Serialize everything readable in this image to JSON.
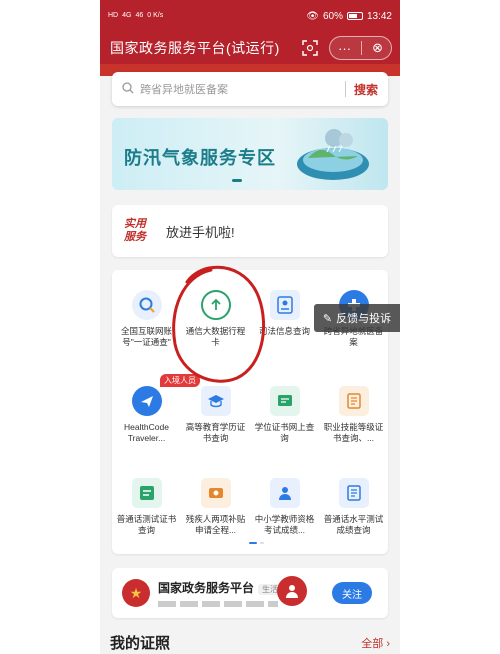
{
  "status_bar": {
    "left_icons": [
      "HD",
      "4G",
      "46",
      "0 K/s"
    ],
    "battery": "60%",
    "time": "13:42"
  },
  "title_bar": {
    "title": "国家政务服务平台(试运行)",
    "more": "···",
    "close": "⊗"
  },
  "search": {
    "placeholder": "跨省异地就医备案",
    "button": "搜索"
  },
  "flood_banner": {
    "title": "防汛气象服务专区"
  },
  "practical_service": {
    "tag_line1": "实用",
    "tag_line2": "服务",
    "notice": "放进手机啦!"
  },
  "grid": {
    "items": [
      {
        "label": "全国互联网账号\"一证通查\"",
        "icon": "search-icon",
        "color": "#2c7be5"
      },
      {
        "label": "通信大数据行程卡",
        "icon": "arrow-up-icon",
        "color": "#2aa36b"
      },
      {
        "label": "司法信息查询",
        "icon": "id-card-icon",
        "color": "#2c7be5"
      },
      {
        "label": "跨省异地就医备案",
        "icon": "medical-icon",
        "color": "#2c7be5"
      },
      {
        "label": "HealthCode Traveler...",
        "icon": "plane-icon",
        "color": "#2c7be5"
      },
      {
        "label": "高等教育学历证书查询",
        "icon": "graduation-cap-icon",
        "color": "#2c7be5"
      },
      {
        "label": "学位证书网上查询",
        "icon": "certificate-icon",
        "color": "#2aa36b"
      },
      {
        "label": "职业技能等级证书查询、...",
        "icon": "skill-icon",
        "color": "#e5872c"
      },
      {
        "label": "普通话测试证书查询",
        "icon": "mandarin-icon",
        "color": "#2aa36b"
      },
      {
        "label": "残疾人两项补贴申请全程...",
        "icon": "disability-icon",
        "color": "#e5872c"
      },
      {
        "label": "中小学教师资格考试成绩...",
        "icon": "teacher-icon",
        "color": "#2c7be5"
      },
      {
        "label": "普通话水平测试成绩查询",
        "icon": "exam-icon",
        "color": "#2c7be5"
      }
    ],
    "hot_badge": "入境人员"
  },
  "feedback": {
    "label": "反馈与投诉"
  },
  "platform": {
    "name": "国家政务服务平台",
    "tag": "生活号",
    "follow": "关注"
  },
  "my_certificates": {
    "heading": "我的证照",
    "all": "全部 ›"
  },
  "colors": {
    "brand_red": "#b5222b",
    "accent_blue": "#2c7be5",
    "accent_green": "#2aa36b"
  }
}
